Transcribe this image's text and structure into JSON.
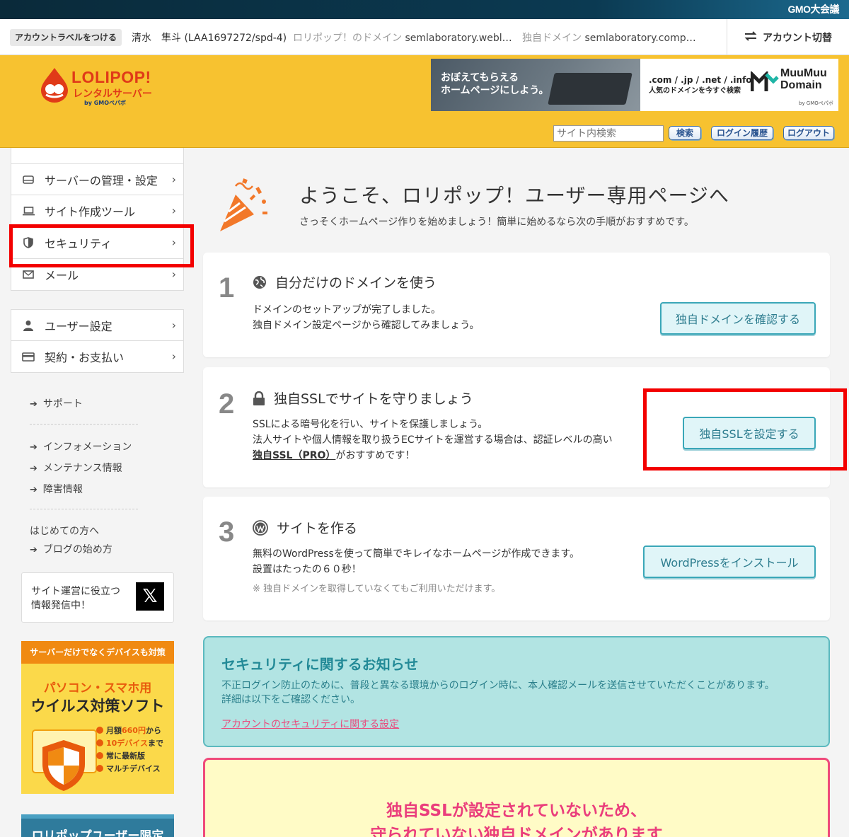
{
  "gmo": {
    "logo_text": "GMO大会議"
  },
  "account": {
    "label_button": "アカウントラベルをつける",
    "name": "清水　隼斗 (LAA1697272/spd-4)",
    "lolipop_domain_key": "ロリポップ！のドメイン",
    "lolipop_domain_value": "semlaboratory.weblik…",
    "own_domain_key": "独自ドメイン",
    "own_domain_value": "semlaboratory.compa…",
    "switch_label": "アカウント切替"
  },
  "header": {
    "logo_main": "LOLIPOP!",
    "logo_sub": "レンタルサーバー",
    "logo_by": "by GMOペパボ",
    "banner_left_text_1": "おぼえてもらえる",
    "banner_left_text_2": "ホームページにしよう。",
    "banner_mid_text_1": ".com / .jp / .net / .info",
    "banner_mid_text_2": "人気のドメインを今すぐ検索",
    "banner_brand_1": "MuuMuu",
    "banner_brand_2": "Domain",
    "banner_brand_by": "by GMOペパボ",
    "search_placeholder": "サイト内検索",
    "search_button": "検索",
    "login_history_button": "ログイン履歴",
    "logout_button": "ログアウト"
  },
  "sidebar": {
    "items": [
      {
        "label": "サーバーの管理・設定"
      },
      {
        "label": "サイト作成ツール"
      },
      {
        "label": "セキュリティ"
      },
      {
        "label": "メール"
      },
      {
        "label": "ユーザー設定"
      },
      {
        "label": "契約・お支払い"
      }
    ],
    "links": [
      "サポート",
      "インフォメーション",
      "メンテナンス情報",
      "障害情報"
    ],
    "beginner_heading": "はじめての方へ",
    "blog_link": "ブログの始め方",
    "x_box_line1": "サイト運営に役立つ",
    "x_box_line2": "情報発信中！",
    "x_glyph": "𝕏",
    "ad1_top": "サーバーだけでなくデバイスも対策",
    "ad1_line1": "パソコン・スマホ用",
    "ad1_line2": "ウイルス対策ソフト",
    "ad1_feat1_pre": "月額",
    "ad1_feat1_hl": "660円",
    "ad1_feat1_post": "から",
    "ad1_feat2_hl": "10デバイス",
    "ad1_feat2_post": "まで",
    "ad1_feat3": "常に最新版",
    "ad1_feat4": "マルチデバイス",
    "ad2_text": "ロリポップユーザー限定"
  },
  "main": {
    "welcome_title": "ようこそ、ロリポップ！ユーザー専用ページへ",
    "welcome_sub": "さっそくホームページ作りを始めましょう！簡単に始めるなら次の手順がおすすめです。",
    "steps": [
      {
        "num": "1",
        "icon": "globe-icon",
        "title": "自分だけのドメインを使う",
        "desc1": "ドメインのセットアップが完了しました。",
        "desc2": "独自ドメイン設定ページから確認してみましょう。",
        "button": "独自ドメインを確認する"
      },
      {
        "num": "2",
        "icon": "lock-icon",
        "title": "独自SSLでサイトを守りましょう",
        "desc1": "SSLによる暗号化を行い、サイトを保護しましょう。",
        "desc2": "法人サイトや個人情報を取り扱うECサイトを運営する場合は、認証レベルの高い",
        "desc3_link": "独自SSL（PRO）",
        "desc3_rest": "がおすすめです！",
        "button": "独自SSLを設定する"
      },
      {
        "num": "3",
        "icon": "wordpress-icon",
        "title": "サイトを作る",
        "desc1": "無料のWordPressを使って簡単でキレイなホームページが作成できます。",
        "desc2": "設置はたったの６０秒！",
        "note": "※ 独自ドメインを取得していなくてもご利用いただけます。",
        "button": "WordPressをインストール"
      }
    ],
    "security_notice": {
      "heading": "セキュリティに関するお知らせ",
      "line1": "不正ログイン防止のために、普段と異なる環境からのログイン時に、本人確認メールを送信させていただくことがあります。",
      "line2": "詳細は以下をご確認ください。",
      "link": "アカウントのセキュリティに関する設定"
    },
    "ssl_warning": {
      "line1": "独自SSLが設定されていないため、",
      "line2": "守られていない独自ドメインがあります"
    }
  },
  "colors": {
    "header_yellow": "#f7c230",
    "brand_red": "#e03a18",
    "highlight_red": "#f30000",
    "teal_button": "#3aa7b8",
    "warning_pink": "#ea3d7c"
  }
}
